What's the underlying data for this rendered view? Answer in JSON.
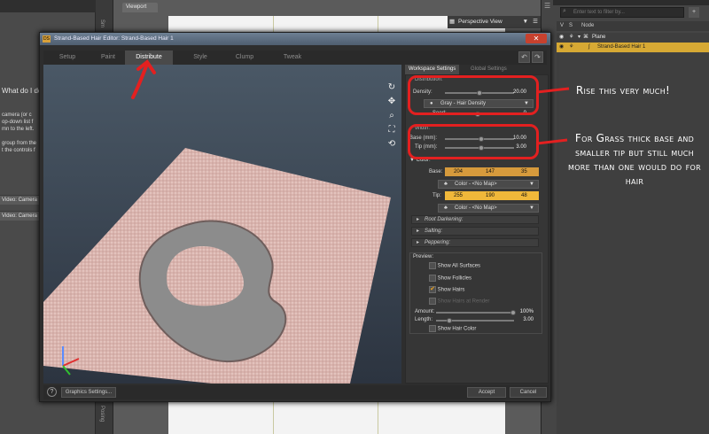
{
  "left_panel": {
    "question": "What do I do",
    "paragraph1": "camera (or c\nop-down list f\nmn to the left.",
    "paragraph2": "group from the\nt the controls f",
    "video_row_1": "Video: Camera",
    "video_row_2": "Video: Camera"
  },
  "side_strips": {
    "upper": "Sm",
    "lower": "Posing"
  },
  "viewport": {
    "tab": "Viewport",
    "camera_label": "Perspective View"
  },
  "scene_panel": {
    "filter_placeholder": "Enter text to filter by...",
    "col_v": "V",
    "col_s": "S",
    "col_node": "Node",
    "rows": [
      {
        "label": "Plane"
      },
      {
        "label": "Strand-Based Hair 1"
      }
    ]
  },
  "dialog": {
    "title": "Strand-Based Hair Editor: Strand-Based Hair 1",
    "close_icon": "close-icon",
    "tabs": [
      "Setup",
      "Paint",
      "Distribute",
      "Style",
      "Clump",
      "Tweak"
    ],
    "active_tab": "Distribute",
    "workspace_tabs": [
      "Workspace Settings",
      "Global Settings"
    ],
    "distribution": {
      "header": "Distribution:",
      "density_label": "Density:",
      "density_value": "20.00",
      "density_fraction": 0.5,
      "density_map": "Gray - Hair Density",
      "seed_label": "Seed:",
      "seed_value": "0"
    },
    "width": {
      "header": "Width:",
      "base_label": "Base (mm):",
      "base_value": "10.00",
      "tip_label": "Tip (mm):",
      "tip_value": "3.00"
    },
    "color": {
      "header": "Color:",
      "base_label": "Base:",
      "base_rgb": [
        "204",
        "147",
        "35"
      ],
      "base_map": "Color - <No Map>",
      "tip_label": "Tip:",
      "tip_rgb": [
        "255",
        "190",
        "48"
      ],
      "tip_map": "Color - <No Map>",
      "sections": [
        "Root Darkening:",
        "Salting:",
        "Peppering:"
      ]
    },
    "preview": {
      "header": "Preview:",
      "show_all_surfaces": "Show All Surfaces",
      "show_follicles": "Show Follicles",
      "show_hairs": "Show Hairs",
      "show_hairs_at_render": "Show Hairs at Render",
      "amount_label": "Amount:",
      "amount_value": "100%",
      "length_label": "Length:",
      "length_value": "3.00",
      "show_hair_color": "Show Hair Color"
    },
    "footer": {
      "graphics_settings": "Graphics Settings...",
      "accept": "Accept",
      "cancel": "Cancel"
    }
  },
  "annotations": {
    "note1": "Rise this very much!",
    "note2": "For Grass thick base and smaller tip but still much more than one would do for hair"
  },
  "colors": {
    "annotation_red": "#e32020",
    "fur": "#d9b3ad",
    "selected_row": "#d7a934",
    "color_bar": "#d69a3c"
  }
}
